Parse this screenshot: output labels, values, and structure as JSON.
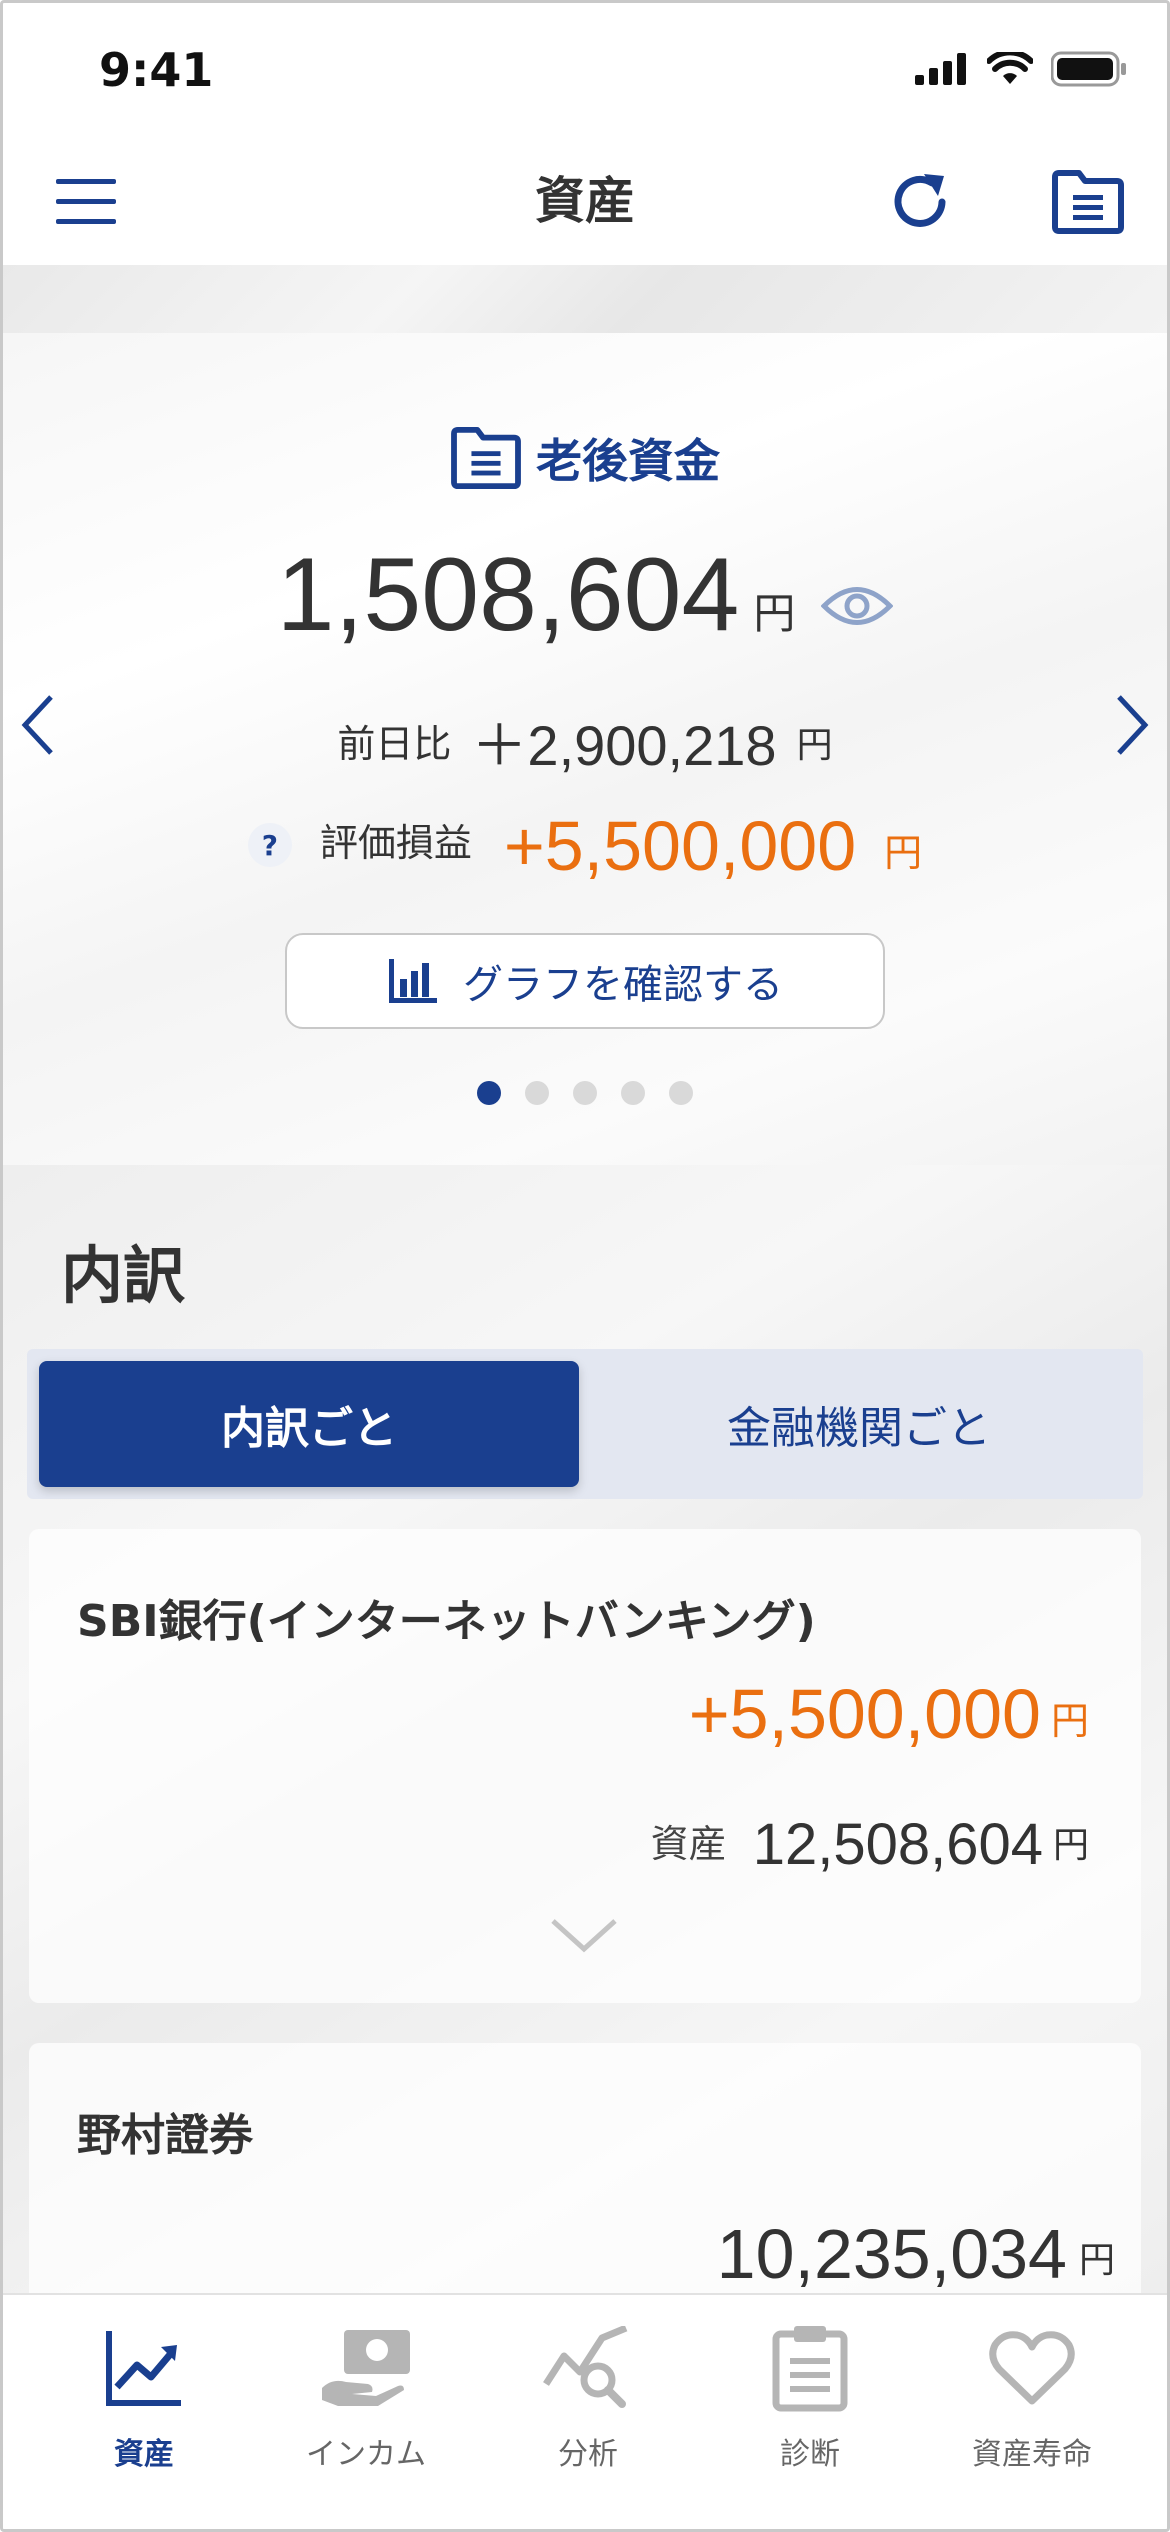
{
  "status_bar": {
    "time": "9:41"
  },
  "navbar": {
    "title": "資産"
  },
  "hero": {
    "folder_label": "老後資金",
    "total_amount": "1,508,604",
    "unit": "円",
    "prev_day_label": "前日比",
    "prev_day_value": "＋2,900,218",
    "pl_help": "?",
    "pl_label": "評価損益",
    "pl_value": "+5,500,000",
    "graph_button": "グラフを確認する",
    "pager": {
      "count": 5,
      "active": 1
    }
  },
  "breakdown": {
    "title": "内訳",
    "tabs": [
      {
        "label": "内訳ごと",
        "active": true
      },
      {
        "label": "金融機関ごと",
        "active": false
      }
    ],
    "accounts": [
      {
        "name": "SBI銀行(インターネットバンキング)",
        "pl_value": "+5,500,000",
        "asset_label": "資産",
        "asset_value": "12,508,604"
      },
      {
        "name": "野村證券",
        "asset_value": "10,235,034"
      }
    ]
  },
  "tabbar": {
    "items": [
      {
        "label": "資産",
        "icon": "chart-up-icon",
        "active": true
      },
      {
        "label": "インカム",
        "icon": "income-icon",
        "active": false
      },
      {
        "label": "分析",
        "icon": "analysis-icon",
        "active": false
      },
      {
        "label": "診断",
        "icon": "clipboard-icon",
        "active": false
      },
      {
        "label": "資産寿命",
        "icon": "heart-icon",
        "active": false
      }
    ]
  },
  "colors": {
    "brand": "#1a3f8f",
    "accent_orange": "#ea6f10"
  }
}
